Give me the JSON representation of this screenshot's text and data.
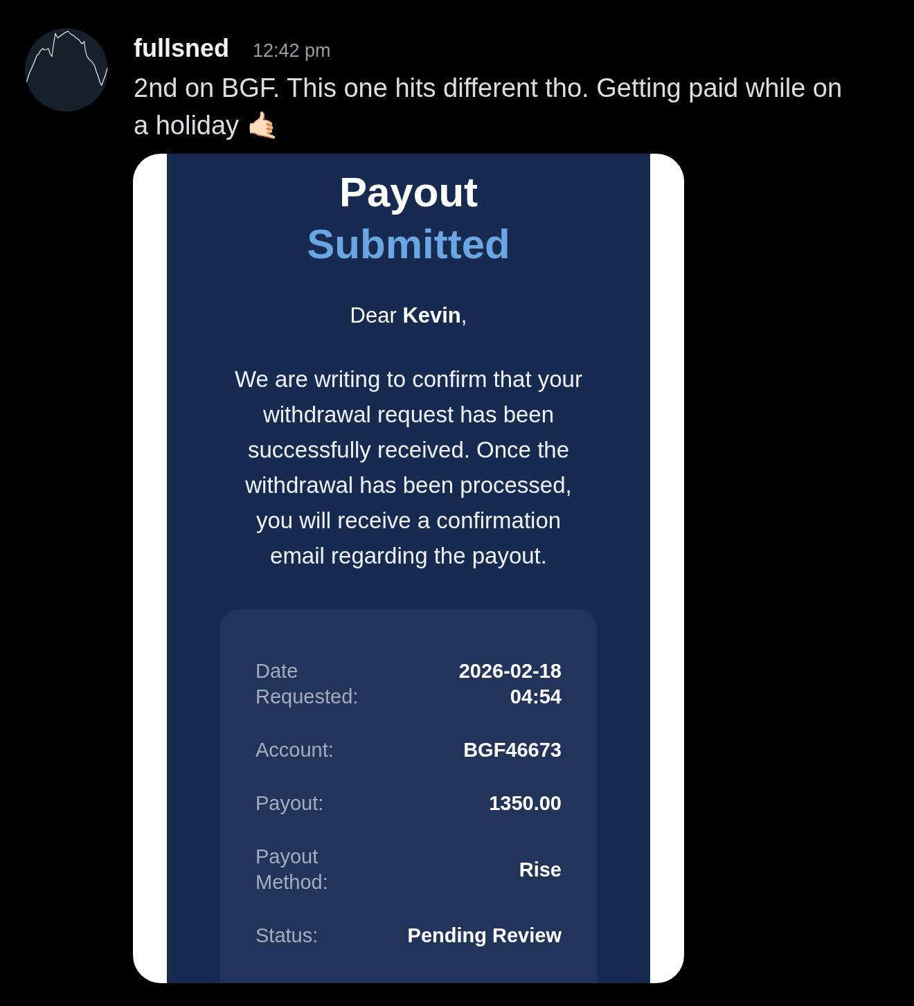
{
  "message": {
    "author": "fullsned",
    "time": "12:42 pm",
    "text": "2nd on BGF. This one hits different tho. Getting paid while on a holiday 🤙🏻"
  },
  "attachment": {
    "title": "Payout",
    "subtitle": "Submitted",
    "greeting": "Dear **Kevin**,",
    "body": "We are writing to confirm that your withdrawal request has been successfully received. Once the withdrawal has been processed, you will receive a confirmation email regarding the payout.",
    "details": [
      {
        "label": "Date Requested:",
        "value": "2026-02-18 04:54"
      },
      {
        "label": "Account:",
        "value": "BGF46673"
      },
      {
        "label": "Payout:",
        "value": "1350.00"
      },
      {
        "label": "Payout Method:",
        "value": "Rise"
      },
      {
        "label": "Status:",
        "value": "Pending Review"
      }
    ]
  }
}
